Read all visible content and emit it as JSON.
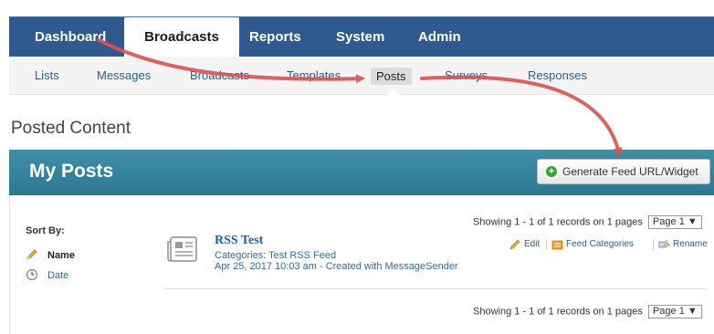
{
  "topnav": {
    "items": [
      {
        "label": "Dashboard",
        "active": false
      },
      {
        "label": "Broadcasts",
        "active": true
      },
      {
        "label": "Reports",
        "active": false
      },
      {
        "label": "System",
        "active": false
      },
      {
        "label": "Admin",
        "active": false
      }
    ]
  },
  "subnav": {
    "items": [
      {
        "label": "Lists",
        "active": false
      },
      {
        "label": "Messages",
        "active": false
      },
      {
        "label": "Broadcasts",
        "active": false
      },
      {
        "label": "Templates",
        "active": false
      },
      {
        "label": "Posts",
        "active": true
      },
      {
        "label": "Surveys",
        "active": false
      },
      {
        "label": "Responses",
        "active": false
      }
    ]
  },
  "page": {
    "title": "Posted Content"
  },
  "panel": {
    "title": "My Posts",
    "generate_button": "Generate Feed URL/Widget",
    "generate_icon": "plus-circle-icon"
  },
  "sort": {
    "label": "Sort By:",
    "options": [
      {
        "label": "Name",
        "icon": "pencil-icon",
        "selected": true
      },
      {
        "label": "Date",
        "icon": "clock-icon",
        "selected": false
      }
    ]
  },
  "pagination": {
    "top_text": "Showing 1 - 1 of 1 records on 1 pages",
    "bottom_text": "Showing 1 - 1 of 1 records on 1 pages",
    "page_select": "Page 1 ▼"
  },
  "posts": [
    {
      "title": "RSS Test",
      "categories": "Categories: Test RSS Feed",
      "created": "Apr 25, 2017 10:03 am - Created with MessageSender",
      "icon": "news-article-icon"
    }
  ],
  "post_actions": {
    "edit": "Edit",
    "feed_categories": "Feed Categories",
    "rename": "Rename"
  },
  "colors": {
    "topnav_bg": "#2f5a8f",
    "panel_header_bg": "#3484a0",
    "link": "#2a5d96",
    "annotation_arrow": "#d9534f"
  }
}
